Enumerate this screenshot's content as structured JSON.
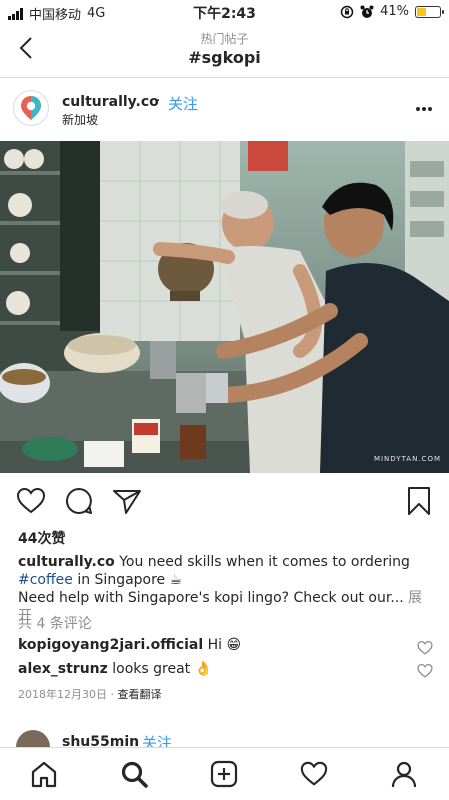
{
  "status_bar": {
    "carrier": "中国移动",
    "network": "4G",
    "time": "下午2:43",
    "battery": "41%",
    "battery_level": 0.41
  },
  "nav": {
    "subtitle": "热门帖子",
    "title": "#sgkopi"
  },
  "post": {
    "username": "culturally.co",
    "dot": "·",
    "follow": "关注",
    "location": "新加坡",
    "watermark": "MINDYTAN.COM",
    "likes": "44次赞",
    "caption": {
      "username": "culturally.co",
      "text1": " You need skills when it comes to ordering ",
      "hashtag": "#coffee",
      "text2": " in Singapore ☕",
      "line2": "Need help with Singapore's kopi lingo? Check out our...",
      "more": " 展开"
    },
    "comments_count": "共 4 条评论",
    "comments": [
      {
        "username": "kopigoyang2jari.official",
        "text": " Hi 😁"
      },
      {
        "username": "alex_strunz",
        "text": " looks great 👌"
      }
    ],
    "date": "2018年12月30日",
    "date_sep": " · ",
    "translate": "查看翻译"
  },
  "next_post": {
    "username": "shu55min",
    "dot": "·",
    "follow": "关注"
  },
  "colors": {
    "link_blue": "#3897f0",
    "hashtag_blue": "#1c4e8e",
    "battery_yellow": "#f5c518",
    "text": "#262626",
    "muted": "#8e8e8e"
  }
}
